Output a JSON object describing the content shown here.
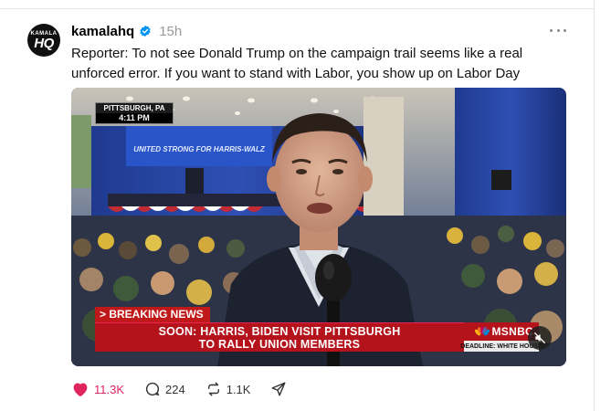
{
  "post": {
    "username": "kamalahq",
    "time": "15h",
    "text": "Reporter: To not see Donald Trump on the campaign trail seems like a real unforced error. If you want to stand with Labor, you show up on Labor Day",
    "avatar": {
      "top_text": "KAMALA",
      "main_text": "HQ"
    }
  },
  "video": {
    "location": "PITTSBURGH, PA",
    "local_time": "4:11 PM",
    "stage_banner": "UNITED STRONG FOR HARRIS-WALZ",
    "breaking_label": "> BREAKING NEWS",
    "headline_line1": "SOON: HARRIS, BIDEN VISIT PITTSBURGH",
    "headline_line2": "TO RALLY UNION MEMBERS",
    "network": "MSNBC",
    "show_bar": "DEADLINE: WHITE HOUSE"
  },
  "actions": {
    "likes": "11.3K",
    "replies": "224",
    "reposts": "1.1K"
  },
  "colors": {
    "like": "#e0245e",
    "verified": "#0095f6",
    "chyron_red": "#b4131b"
  },
  "icons": [
    "verified-badge-icon",
    "more-icon",
    "heart-icon",
    "reply-icon",
    "repost-icon",
    "share-icon",
    "mute-icon",
    "peacock-icon"
  ]
}
